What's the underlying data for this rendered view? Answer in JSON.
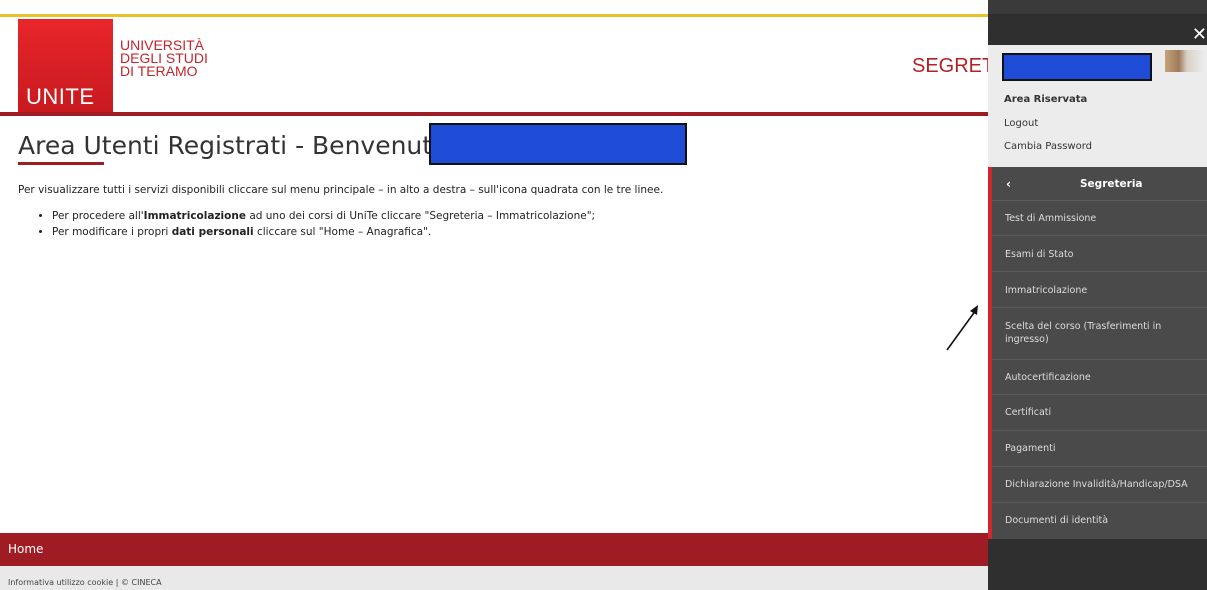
{
  "header": {
    "logo_text": "UNITE",
    "university_line1": "UNIVERSITÀ",
    "university_line2": "DEGLI STUDI",
    "university_line3": "DI TERAMO",
    "section_partial": "SEGRET"
  },
  "main": {
    "title": "Area Utenti Registrati - Benvenuto",
    "intro": "Per visualizzare tutti i servizi disponibili cliccare sul menu principale – in alto a destra – sull'icona quadrata con le tre linee.",
    "bullet1_pre": "Per procedere all'",
    "bullet1_bold": "Immatricolazione",
    "bullet1_post": " ad uno dei corsi di UniTe cliccare \"Segreteria – Immatricolazione\";",
    "bullet2_pre": "Per modificare i propri ",
    "bullet2_bold": "dati personali",
    "bullet2_post": " cliccare sul \"Home – Anagrafica\"."
  },
  "footer": {
    "nav_home": "Home",
    "bottom_text": "Informativa utilizzo cookie | © CINECA"
  },
  "panel": {
    "area_riservata": "Area Riservata",
    "logout": "Logout",
    "cambia_password": "Cambia Password",
    "menu_title": "Segreteria",
    "back_icon": "‹",
    "items": [
      "Test di Ammissione",
      "Esami di Stato",
      "Immatricolazione",
      "Scelta del corso (Trasferimenti in ingresso)",
      "Autocertificazione",
      "Certificati",
      "Pagamenti",
      "Dichiarazione Invalidità/Handicap/DSA",
      "Documenti di identità"
    ]
  },
  "colors": {
    "accent_red": "#a01c24",
    "logo_red": "#e8262a",
    "redaction_blue": "#1f4cd6",
    "panel_dark": "#4a4a4a"
  }
}
